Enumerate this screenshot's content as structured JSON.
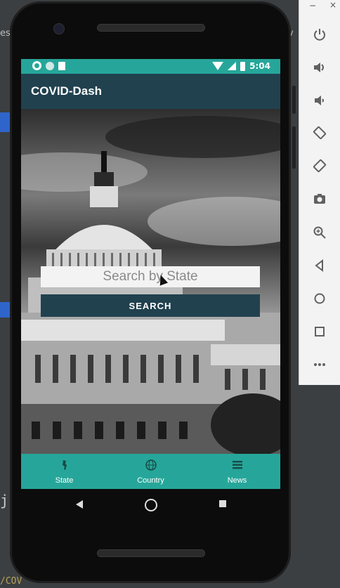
{
  "window": {
    "emulator_minimize": "−",
    "emulator_close": "×"
  },
  "ide_background": {
    "left_text": "es",
    "right_text": "v",
    "bottom_text": "/COV",
    "left_char": "j"
  },
  "status_bar": {
    "time": "5:04",
    "icons_left": [
      "settings-icon",
      "circle-icon",
      "sd-card-icon"
    ],
    "icons_right": [
      "wifi-icon",
      "signal-icon",
      "battery-icon"
    ],
    "color": "#26a69a"
  },
  "app_bar": {
    "title": "COVID-Dash",
    "color": "#21414f"
  },
  "search": {
    "placeholder": "Search by State",
    "button_label": "SEARCH"
  },
  "bottom_nav": {
    "items": [
      {
        "label": "State",
        "icon": "state-map-icon"
      },
      {
        "label": "Country",
        "icon": "globe-icon"
      },
      {
        "label": "News",
        "icon": "news-icon"
      }
    ],
    "color": "#26a69a"
  },
  "emulator_controls": [
    {
      "name": "power-icon"
    },
    {
      "name": "volume-up-icon"
    },
    {
      "name": "volume-down-icon"
    },
    {
      "name": "rotate-left-icon"
    },
    {
      "name": "rotate-right-icon"
    },
    {
      "name": "camera-icon"
    },
    {
      "name": "zoom-icon"
    },
    {
      "name": "back-icon"
    },
    {
      "name": "home-icon"
    },
    {
      "name": "overview-icon"
    },
    {
      "name": "more-icon"
    }
  ]
}
